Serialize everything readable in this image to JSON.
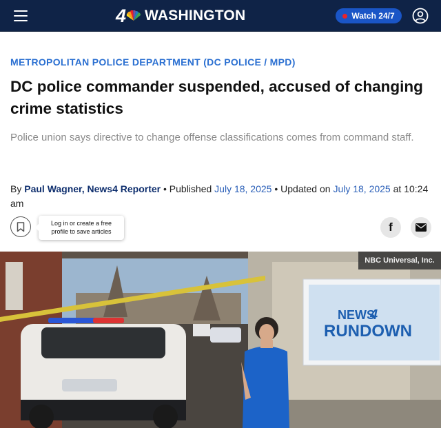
{
  "header": {
    "logo_number": "4",
    "logo_text": "WASHINGTON",
    "watch_label": "Watch 24/7"
  },
  "article": {
    "kicker": "METROPOLITAN POLICE DEPARTMENT (DC POLICE / MPD)",
    "headline": "DC police commander suspended, accused of changing crime statistics",
    "subhead": "Police union says directive to change offense classifications comes from command staff.",
    "byline": {
      "by": "By ",
      "author": "Paul Wagner, News4 Reporter",
      "sep1": " • Published ",
      "published": "July 18, 2025",
      "sep2": " • Updated on ",
      "updated": "July 18, 2025",
      "updated_time": " at 10:24 am"
    }
  },
  "save": {
    "tooltip_line1": "Log in or create a free",
    "tooltip_line2": "profile to save articles"
  },
  "share": {
    "facebook_glyph": "f"
  },
  "media": {
    "credit": "NBC Universal, Inc.",
    "screen_news": "NEWS",
    "screen_four": "4",
    "screen_rundown": "RUNDOWN"
  },
  "colors": {
    "header_bg": "#0f2347",
    "accent_blue": "#2a6fd1",
    "watch_button": "#1a55c6",
    "live_dot": "#e8232a"
  },
  "icons": [
    "menu-icon",
    "peacock-logo-icon",
    "live-dot-icon",
    "user-profile-icon",
    "bookmark-icon",
    "facebook-icon",
    "email-icon"
  ]
}
